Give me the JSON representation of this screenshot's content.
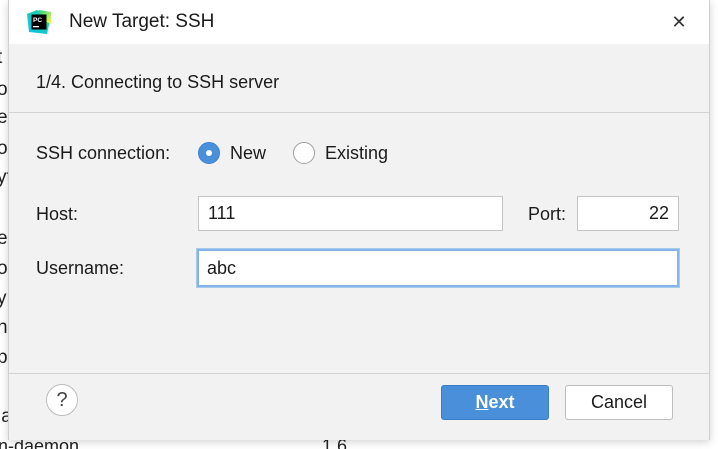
{
  "background": {
    "fragments": [
      "t",
      "o",
      "e",
      "o",
      "yt",
      "e",
      "o",
      "y",
      "n",
      "p",
      "l",
      "la"
    ],
    "bottom_left": "n-daemon",
    "bottom_mid": "1.6"
  },
  "dialog": {
    "title": "New Target: SSH",
    "close_glyph": "✕",
    "step_title": "1/4. Connecting to SSH server",
    "ssh_connection_label": "SSH connection:",
    "radio_new_label": "New",
    "radio_existing_label": "Existing",
    "selected_connection": "New",
    "host_label": "Host:",
    "host_value": "111",
    "port_label": "Port:",
    "port_value": "22",
    "username_label": "Username:",
    "username_value": "abc",
    "help_glyph": "?",
    "next_mnemonic": "N",
    "next_rest": "ext",
    "cancel_label": "Cancel"
  },
  "colors": {
    "accent": "#4a8fd9",
    "dialog_bg": "#f2f2f2",
    "focus_border": "#84b3e8"
  },
  "icons": {
    "app": "pycharm-icon",
    "close": "close-icon",
    "help": "help-icon"
  }
}
